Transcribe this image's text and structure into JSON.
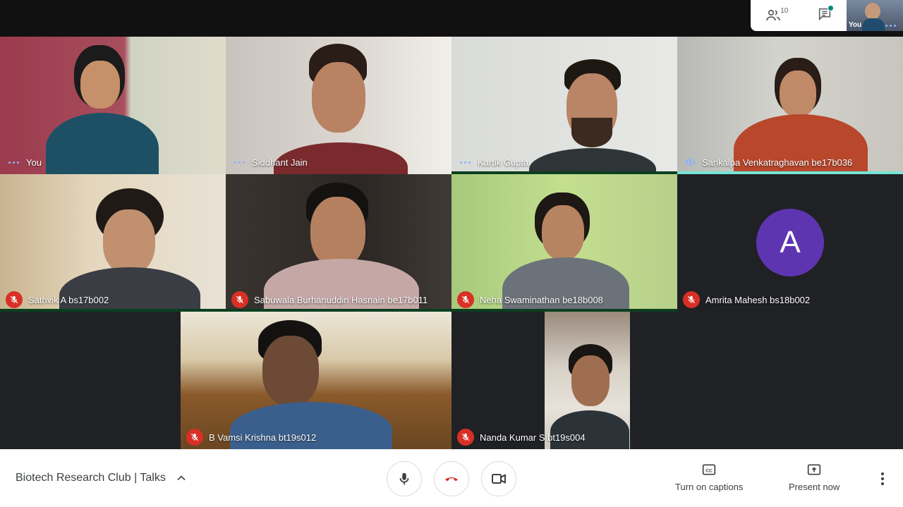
{
  "topbar": {
    "participants_count": "10",
    "participants_icon": "people-icon",
    "chat_icon": "chat-icon",
    "self_view_label": "You"
  },
  "tiles": [
    {
      "name": "You",
      "status": "speaking-dots"
    },
    {
      "name": "Siddhant Jain",
      "status": "speaking-dots"
    },
    {
      "name": "Kartik Gupta",
      "status": "speaking-dots"
    },
    {
      "name": "Sankalpa Venkatraghavan be17b036",
      "status": "speaking-bars"
    },
    {
      "name": "Sathvik A bs17b002",
      "status": "muted"
    },
    {
      "name": "Sabuwala Burhanuddin Hasnain be17b011",
      "status": "muted"
    },
    {
      "name": "Neha Swaminathan be18b008",
      "status": "muted"
    },
    {
      "name": "Amrita Mahesh bs18b002",
      "status": "muted",
      "avatar_letter": "A",
      "avatar_color": "#5e35b1"
    },
    {
      "name": "B Vamsi Krishna bt19s012",
      "status": "muted"
    },
    {
      "name": "Nanda Kumar S bt19s004",
      "status": "muted"
    }
  ],
  "bottombar": {
    "meeting_title": "Biotech Research Club | Talks",
    "chevron_icon": "chevron-up-icon",
    "mic_icon": "microphone-icon",
    "hangup_icon": "hang-up-icon",
    "camera_icon": "video-camera-icon",
    "captions_label": "Turn on captions",
    "captions_icon": "closed-captions-icon",
    "present_label": "Present now",
    "present_icon": "present-screen-icon",
    "more_icon": "more-vertical-icon"
  },
  "colors": {
    "hangup_red": "#d93025",
    "active_speaker": "#00bfa5",
    "mute_red": "#d93025",
    "accent_blue": "#8ab4f8"
  }
}
